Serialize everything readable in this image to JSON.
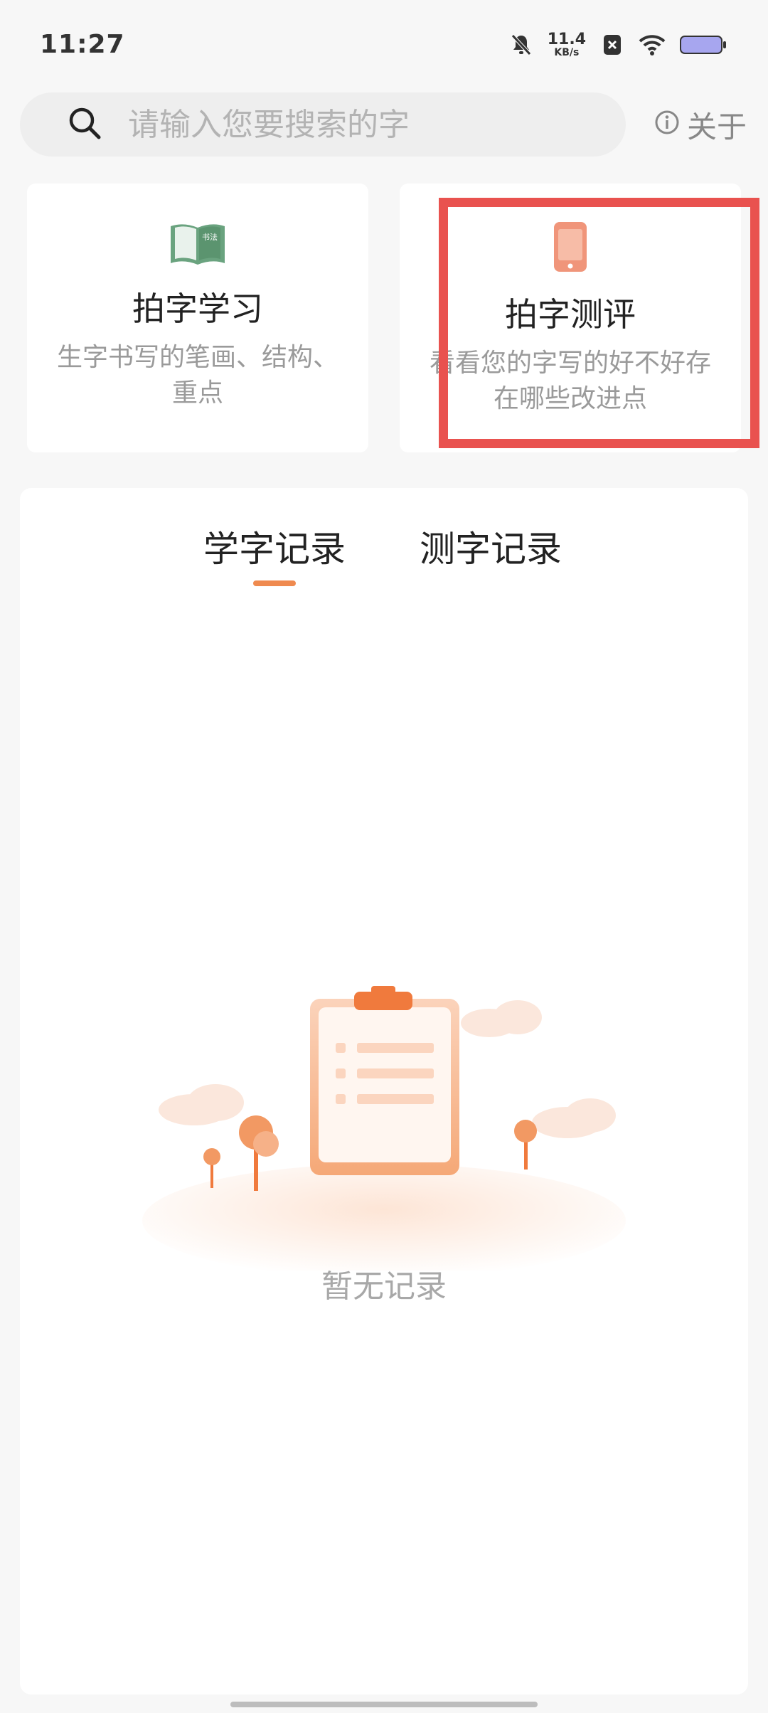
{
  "status_bar": {
    "time": "11:27",
    "net_speed_value": "11.4",
    "net_speed_unit": "KB/s",
    "icons": [
      "bell-mute-icon",
      "sim-disabled-icon",
      "wifi-icon",
      "battery-icon"
    ]
  },
  "search": {
    "placeholder": "请输入您要搜索的字",
    "about_label": "关于"
  },
  "cards": [
    {
      "title": "拍字学习",
      "desc": "生字书写的笔画、结构、重点",
      "icon": "calligraphy-book-icon",
      "icon_text": "书法"
    },
    {
      "title": "拍字测评",
      "desc": "看看您的字写的好不好存在哪些改进点",
      "icon": "phone-icon"
    }
  ],
  "records": {
    "tabs": [
      {
        "label": "学字记录",
        "active": true
      },
      {
        "label": "测字记录",
        "active": false
      }
    ],
    "empty_text": "暂无记录"
  },
  "colors": {
    "accent": "#ef8a4f",
    "highlight": "#e9524f",
    "book_green": "#6aa37f",
    "phone_orange": "#f0957a"
  }
}
